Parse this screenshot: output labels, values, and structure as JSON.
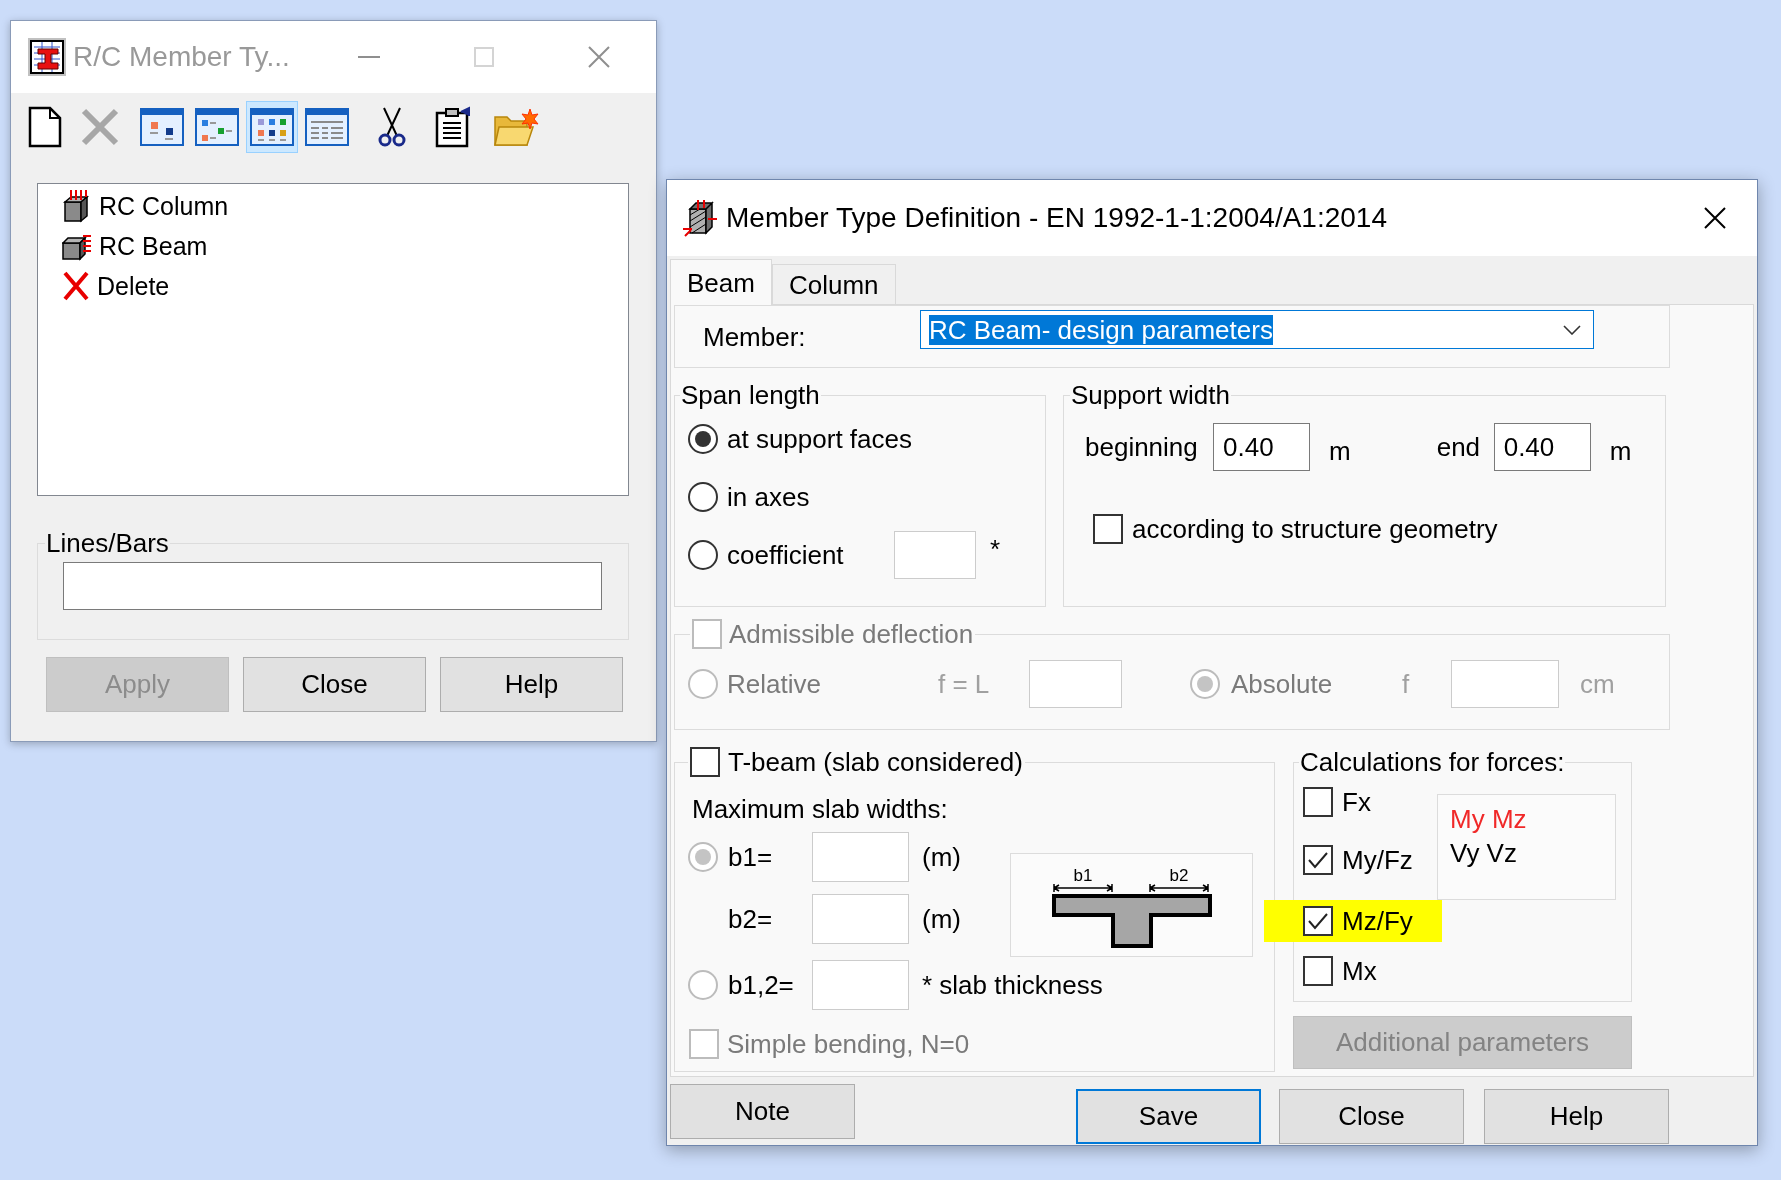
{
  "rc_window": {
    "title": "R/C Member Ty...",
    "active": false,
    "window_controls": [
      {
        "kind": "minimize",
        "disabled": false
      },
      {
        "kind": "maximize",
        "disabled": true
      },
      {
        "kind": "close",
        "disabled": false
      }
    ],
    "toolbar": [
      {
        "items": [
          {
            "kind": "new",
            "selected": false,
            "disabled": false
          },
          {
            "kind": "delete",
            "selected": false,
            "disabled": true
          }
        ]
      },
      {
        "items": [
          {
            "kind": "blocks",
            "selected": false,
            "disabled": false
          },
          {
            "kind": "tree",
            "selected": false,
            "disabled": false
          },
          {
            "kind": "grid",
            "selected": true,
            "disabled": false
          },
          {
            "kind": "table",
            "selected": false,
            "disabled": false
          }
        ]
      },
      {
        "items": [
          {
            "kind": "cut",
            "selected": false,
            "disabled": false
          },
          {
            "kind": "paste",
            "selected": false,
            "disabled": false
          },
          {
            "kind": "open",
            "selected": false,
            "disabled": false
          }
        ]
      }
    ],
    "member_types": [
      {
        "kind": "column",
        "label": "RC Column",
        "selected": false
      },
      {
        "kind": "beam",
        "label": "RC Beam",
        "selected": false
      },
      {
        "kind": "delete",
        "label": "Delete",
        "selected": false
      }
    ],
    "lines_bars": {
      "label": "Lines/Bars"
    },
    "buttons": [
      {
        "label": "Apply",
        "disabled": true
      },
      {
        "label": "Close",
        "disabled": false
      },
      {
        "label": "Help",
        "disabled": false
      }
    ]
  },
  "definition_dialog": {
    "title": "Member Type Definition - EN 1992-1-1:2004/A1:2014",
    "active": true,
    "window_controls": [
      {
        "kind": "close",
        "disabled": false
      }
    ],
    "tabs": [
      {
        "label": "Beam",
        "selected": true
      },
      {
        "label": "Column",
        "selected": false
      }
    ],
    "member": {
      "label": "Member:",
      "value": "RC Beam- design parameters",
      "focused": true
    },
    "span_length": {
      "title": "Span length",
      "options": [
        {
          "label": "at support faces",
          "selected": true
        },
        {
          "label": "in axes",
          "selected": false
        },
        {
          "label": "coefficient",
          "selected": false
        }
      ],
      "coefficient_mark": "*"
    },
    "support_width": {
      "title": "Support width",
      "fields": [
        {
          "label": "beginning",
          "value": "0.40",
          "unit": "m"
        },
        {
          "label": "end",
          "value": "0.40",
          "unit": "m"
        }
      ],
      "geometry": {
        "label": "according to structure geometry",
        "checked": false
      }
    },
    "deflection": {
      "label": "Admissible deflection",
      "checked": false,
      "disabled": true,
      "modes": [
        {
          "label": "Relative",
          "selected": false
        },
        {
          "label": "Absolute",
          "selected": true
        }
      ],
      "relative_formula": "f = L",
      "absolute_symbol": "f",
      "absolute_unit": "cm"
    },
    "t_beam": {
      "label": "T-beam (slab considered)",
      "checked": false,
      "subtitle": "Maximum slab widths:",
      "widths": [
        {
          "kind": "radio",
          "label": "b1=",
          "unit": "(m)",
          "selected": true,
          "disabled": true
        },
        {
          "kind": "plain",
          "label": "b2=",
          "unit": "(m)"
        },
        {
          "kind": "radio",
          "label": "b1,2=",
          "unit": "* slab thickness",
          "selected": false,
          "disabled": true
        }
      ],
      "diagram_labels": [
        "b1",
        "b2"
      ],
      "simple_bending": {
        "label": "Simple bending, N=0",
        "checked": false,
        "disabled": true
      }
    },
    "forces": {
      "title": "Calculations for forces:",
      "items": [
        {
          "label": "Fx",
          "checked": false,
          "highlighted": false
        },
        {
          "label": "My/Fz",
          "checked": true,
          "highlighted": false
        },
        {
          "label": "Mz/Fy",
          "checked": true,
          "highlighted": true
        },
        {
          "label": "Mx",
          "checked": false,
          "highlighted": false
        }
      ],
      "color_key": [
        {
          "text": "My Mz",
          "color": "#f02828"
        },
        {
          "text": "Vy Vz",
          "color": "#000000"
        }
      ]
    },
    "additional_parameters": {
      "label": "Additional parameters",
      "disabled": true
    },
    "buttons": [
      {
        "label": "Note",
        "focused": false
      },
      {
        "label": "Save",
        "focused": true
      },
      {
        "label": "Close",
        "focused": false
      },
      {
        "label": "Help",
        "focused": false
      }
    ]
  }
}
